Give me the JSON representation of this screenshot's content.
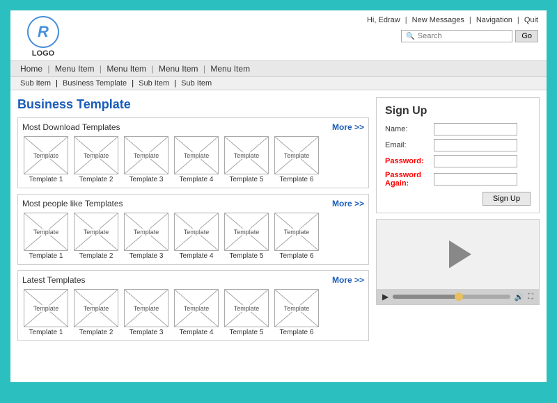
{
  "header": {
    "logo_text": "LOGO",
    "logo_symbol": "R",
    "nav_items": [
      "Hi, Edraw",
      "New Messages",
      "Navigation",
      "Quit"
    ],
    "search_placeholder": "Search",
    "go_button_label": "Go"
  },
  "nav": {
    "main_items": [
      "Home",
      "Menu Item",
      "Menu Item",
      "Menu Item",
      "Menu Item"
    ],
    "sub_items": [
      "Sub Item",
      "Business Template",
      "Sub Item",
      "Sub Item"
    ]
  },
  "page": {
    "title": "Business Template"
  },
  "sections": [
    {
      "id": "most-download",
      "title": "Most Download Templates",
      "more_label": "More >>",
      "templates": [
        {
          "label": "Template",
          "caption": "Template 1"
        },
        {
          "label": "Template",
          "caption": "Template 2"
        },
        {
          "label": "Template",
          "caption": "Template 3"
        },
        {
          "label": "Template",
          "caption": "Template 4"
        },
        {
          "label": "Template",
          "caption": "Template 5"
        },
        {
          "label": "Template",
          "caption": "Template 6"
        }
      ]
    },
    {
      "id": "most-liked",
      "title": "Most people like Templates",
      "more_label": "More >>",
      "templates": [
        {
          "label": "Template",
          "caption": "Template 1"
        },
        {
          "label": "Template",
          "caption": "Template 2"
        },
        {
          "label": "Template",
          "caption": "Template 3"
        },
        {
          "label": "Template",
          "caption": "Template 4"
        },
        {
          "label": "Template",
          "caption": "Template 5"
        },
        {
          "label": "Template",
          "caption": "Template 6"
        }
      ]
    },
    {
      "id": "latest",
      "title": "Latest Templates",
      "more_label": "More >>",
      "templates": [
        {
          "label": "Template",
          "caption": "Template 1"
        },
        {
          "label": "Template",
          "caption": "Template 2"
        },
        {
          "label": "Template",
          "caption": "Template 3"
        },
        {
          "label": "Template",
          "caption": "Template 4"
        },
        {
          "label": "Template",
          "caption": "Template 5"
        },
        {
          "label": "Template",
          "caption": "Template 6"
        }
      ]
    }
  ],
  "signup": {
    "title": "Sign Up",
    "fields": [
      {
        "label": "Name:",
        "required": false
      },
      {
        "label": "Email:",
        "required": false
      },
      {
        "label": "Password:",
        "required": true
      },
      {
        "label": "Password Again:",
        "required": true
      }
    ],
    "button_label": "Sign Up"
  },
  "video": {
    "progress_percent": 55
  }
}
